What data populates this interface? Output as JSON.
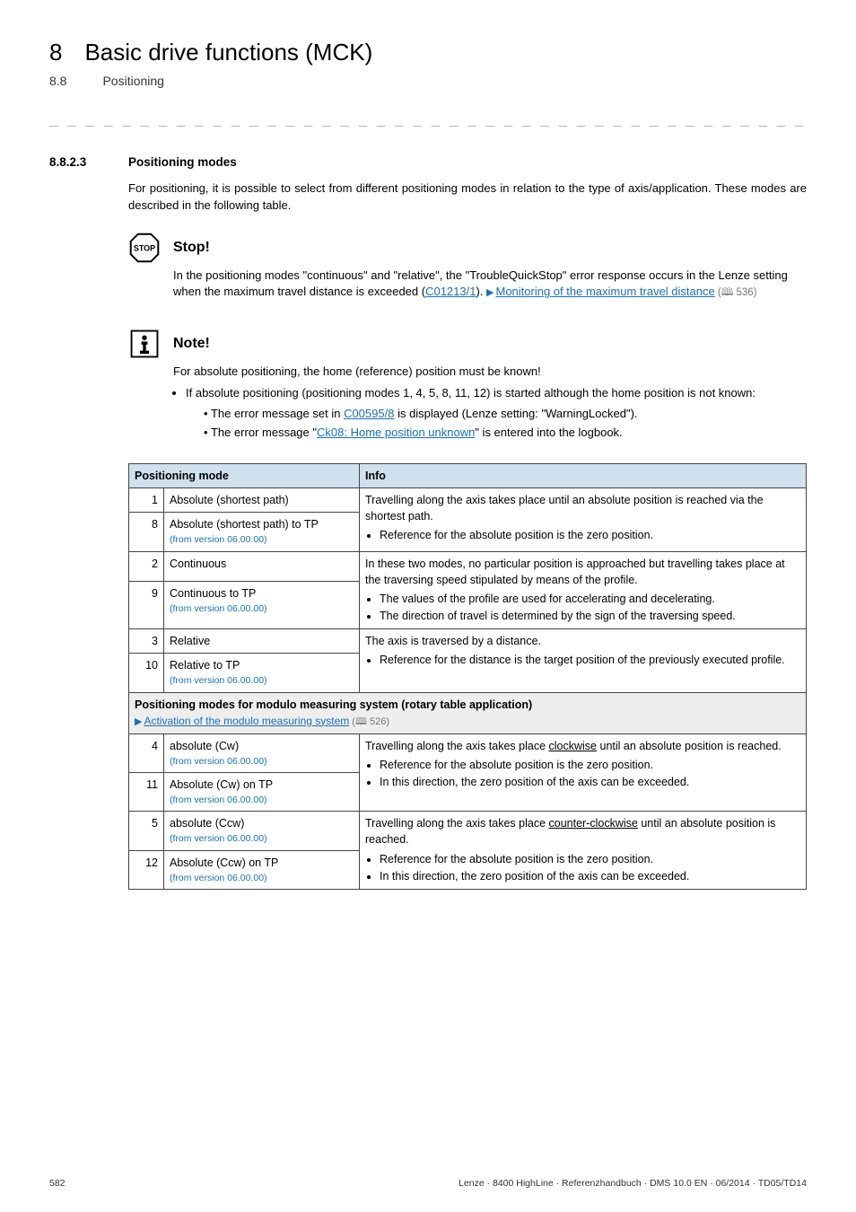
{
  "header": {
    "num": "8",
    "title": "Basic drive functions (MCK)"
  },
  "subheader": {
    "num": "8.8",
    "title": "Positioning"
  },
  "separator": "_ _ _ _ _ _ _ _ _ _ _ _ _ _ _ _ _ _ _ _ _ _ _ _ _ _ _ _ _ _ _ _ _ _ _ _ _ _ _ _ _ _ _ _ _ _ _ _ _ _ _ _ _ _ _ _ _ _ _ _ _ _ _ _",
  "section": {
    "num": "8.8.2.3",
    "title": "Positioning modes"
  },
  "intro": "For positioning, it is possible to select from different positioning modes in relation to the type of axis/application. These modes are described in the following table.",
  "stop": {
    "label": "Stop!",
    "text_pre": "In the positioning modes \"continuous\" and \"relative\", the \"TroubleQuickStop\" error response occurs in the Lenze setting when the maximum travel distance is exceeded (",
    "link1": "C01213/1",
    "text_mid": "). ",
    "tri": "▶",
    "link2": "Monitoring of the maximum travel distance",
    "ref": " (🕮 536)"
  },
  "note": {
    "label": "Note!",
    "line1": "For absolute positioning, the home (reference) position must be known!",
    "bullet": "If absolute positioning (positioning modes 1, 4, 5, 8, 11, 12) is started although the home position is not known:",
    "sub1_pre": "The error message set in ",
    "sub1_link": "C00595/8",
    "sub1_post": " is displayed (Lenze setting: \"WarningLocked\").",
    "sub2_pre": "The error message \"",
    "sub2_link": "Ck08: Home position unknown",
    "sub2_post": "\" is entered into the logbook."
  },
  "table": {
    "head": {
      "c1": "Positioning mode",
      "c2": "Info"
    },
    "ver": "(from version 06.00.00)",
    "group1": {
      "r1": {
        "n": "1",
        "mode": "Absolute (shortest path)"
      },
      "r2": {
        "n": "8",
        "mode": "Absolute (shortest path) to TP"
      },
      "info_a": "Travelling along the axis takes place until an absolute position is reached via the shortest path.",
      "info_b": "Reference for the absolute position is the zero position."
    },
    "group2": {
      "r1": {
        "n": "2",
        "mode": "Continuous"
      },
      "r2": {
        "n": "9",
        "mode": "Continuous to TP"
      },
      "info_a": "In these two modes, no particular position is approached but travelling takes place at the traversing speed stipulated by means of the profile.",
      "info_b": "The values of the profile are used for accelerating and decelerating.",
      "info_c": "The direction of travel is determined by the sign of the traversing speed."
    },
    "group3": {
      "r1": {
        "n": "3",
        "mode": "Relative"
      },
      "r2": {
        "n": "10",
        "mode": "Relative to TP"
      },
      "info_a": "The axis is traversed by a distance.",
      "info_b": "Reference for the distance is the target position of the previously executed profile."
    },
    "sectionhead": {
      "main": "Positioning modes for modulo measuring system (rotary table application)",
      "sub": "Activation of the modulo measuring system",
      "ref": " (🕮 526)"
    },
    "group4": {
      "r1": {
        "n": "4",
        "mode": "absolute (Cw)"
      },
      "r2": {
        "n": "11",
        "mode": "Absolute (Cw) on TP"
      },
      "info_a_pre": "Travelling along the axis takes place ",
      "info_a_u": "clockwise",
      "info_a_post": " until an absolute position is reached.",
      "info_b": "Reference for the absolute position is the zero position.",
      "info_c": "In this direction, the zero position of the axis can be exceeded."
    },
    "group5": {
      "r1": {
        "n": "5",
        "mode": "absolute (Ccw)"
      },
      "r2": {
        "n": "12",
        "mode": "Absolute (Ccw) on TP"
      },
      "info_a_pre": "Travelling along the axis takes place ",
      "info_a_u": "counter-clockwise",
      "info_a_post": " until an absolute position is reached.",
      "info_b": "Reference for the absolute position is the zero position.",
      "info_c": "In this direction, the zero position of the axis can be exceeded."
    }
  },
  "footer": {
    "page": "582",
    "meta": "Lenze · 8400 HighLine · Referenzhandbuch · DMS 10.0 EN · 06/2014 · TD05/TD14"
  }
}
